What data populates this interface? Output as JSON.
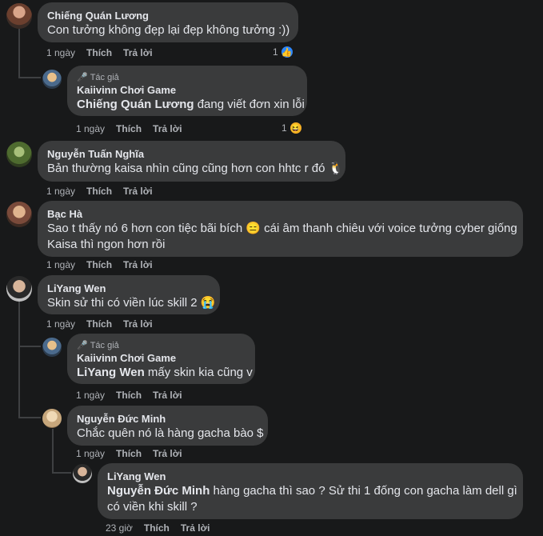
{
  "author_tag": "Tác giả",
  "comments": [
    {
      "name": "Chiếng Quán Lương",
      "text": "Con tưởng không đẹp lại đẹp không tưởng :))",
      "time": "1 ngày",
      "like": "Thích",
      "reply": "Trả lời",
      "reaction_count": "1",
      "reaction": "like-icon"
    },
    {
      "name": "Kaiivinn Chơi Game",
      "mention": "Chiếng Quán Lương",
      "text": "đang viết đơn xin lỗi",
      "time": "1 ngày",
      "like": "Thích",
      "reply": "Trả lời",
      "reaction_count": "1",
      "reaction": "haha-icon"
    },
    {
      "name": "Nguyễn Tuấn Nghĩa",
      "text": "Bản thường kaisa nhìn cũng cũng hơn con hhtc r đó 🐧",
      "time": "1 ngày",
      "like": "Thích",
      "reply": "Trả lời"
    },
    {
      "name": "Bạc Hà",
      "text_line1": "Sao t thấy nó 6 hơn con tiệc bãi bích 😑 cái âm thanh chiêu với voice tưởng cyber giống",
      "text_line2": "Kaisa thì ngon hơn rồi",
      "time": "1 ngày",
      "like": "Thích",
      "reply": "Trả lời"
    },
    {
      "name": "LiYang Wen",
      "text": "Skin sử thi có viền lúc skill 2 😭",
      "time": "1 ngày",
      "like": "Thích",
      "reply": "Trả lời"
    },
    {
      "name": "Kaiivinn Chơi Game",
      "mention": "LiYang Wen",
      "text": "mấy skin kia cũng v",
      "time": "1 ngày",
      "like": "Thích",
      "reply": "Trả lời"
    },
    {
      "name": "Nguyễn Đức Minh",
      "text": "Chắc quên nó là hàng gacha bào $",
      "time": "1 ngày",
      "like": "Thích",
      "reply": "Trả lời"
    },
    {
      "name": "LiYang Wen",
      "mention": "Nguyễn Đức Minh",
      "text_line1": "hàng gacha thì sao ? Sử thi 1 đống con gacha làm dell gì",
      "text_line2": "có viền khi skill ?",
      "time": "23 giờ",
      "like": "Thích",
      "reply": "Trả lời"
    }
  ]
}
